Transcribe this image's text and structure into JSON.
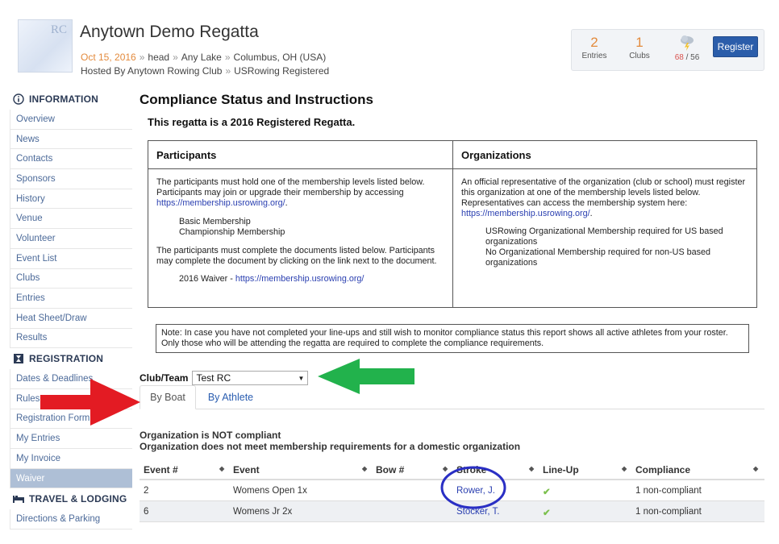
{
  "header": {
    "title": "Anytown Demo Regatta",
    "logo_text": "RC",
    "date": "Oct 15, 2016",
    "breadcrumb": [
      "head",
      "Any Lake",
      "Columbus, OH (USA)"
    ],
    "hosted_by": "Hosted By Anytown Rowing Club",
    "registered": "USRowing Registered",
    "stats": {
      "entries_count": "2",
      "entries_label": "Entries",
      "clubs_count": "1",
      "clubs_label": "Clubs",
      "weather_hi": "68",
      "weather_sep": "/",
      "weather_lo": "56"
    },
    "register_label": "Register"
  },
  "sidebar": {
    "info_heading": "INFORMATION",
    "info_items": [
      "Overview",
      "News",
      "Contacts",
      "Sponsors",
      "History",
      "Venue",
      "Volunteer",
      "Event List",
      "Clubs",
      "Entries",
      "Heat Sheet/Draw",
      "Results"
    ],
    "registration_heading": "REGISTRATION",
    "registration_items": [
      "Dates & Deadlines",
      "Rules",
      "Registration Form",
      "My Entries",
      "My Invoice",
      "Waiver"
    ],
    "travel_heading": "TRAVEL & LODGING",
    "travel_items": [
      "Directions & Parking"
    ]
  },
  "main": {
    "title": "Compliance Status and Instructions",
    "subtitle": "This regatta is a 2016 Registered Regatta.",
    "participants": {
      "heading": "Participants",
      "p1": "The participants must hold one of the membership levels listed below. Participants may join or upgrade their membership by accessing ",
      "link": "https://membership.usrowing.org/",
      "p1_end": ".",
      "levels": [
        "Basic Membership",
        "Championship Membership"
      ],
      "p2": "The participants must complete the documents listed below. Participants may complete the document by clicking on the link next to the document.",
      "doc": "2016 Waiver - ",
      "doc_link": "https://membership.usrowing.org/"
    },
    "organizations": {
      "heading": "Organizations",
      "p1": "An official representative of the organization (club or school) must register this organization at one of the membership levels listed below. Representatives can access the membership system here: ",
      "link": "https://membership.usrowing.org/",
      "p1_end": ".",
      "req1": "USRowing Organizational Membership required for US based organizations",
      "req2": "No Organizational Membership required for non-US based organizations"
    },
    "note": "Note: In case you have not completed your line-ups and still wish to monitor compliance status this report shows all active athletes from your roster. Only those who will be attending the regatta are required to complete the compliance requirements.",
    "club_label": "Club/Team",
    "club_value": "Test RC",
    "tabs": [
      "By Boat",
      "By Athlete"
    ],
    "status_line1": "Organization is NOT compliant",
    "status_line2": "Organization does not meet membership requirements for a domestic organization",
    "table": {
      "headers": [
        "Event #",
        "Event",
        "Bow #",
        "Stroke",
        "Line-Up",
        "Compliance"
      ],
      "rows": [
        {
          "event_num": "2",
          "event": "Womens Open 1x",
          "bow": "",
          "stroke": "Rower, J.",
          "lineup": "✔",
          "compliance": "1 non-compliant"
        },
        {
          "event_num": "6",
          "event": "Womens Jr 2x",
          "bow": "",
          "stroke": "Stocker, T.",
          "lineup": "✔",
          "compliance": "1 non-compliant"
        }
      ]
    }
  },
  "colors": {
    "accent": "#e38a3c",
    "link": "#2a3fb0",
    "primary": "#2b5daa",
    "arrow_red": "#e31b23",
    "arrow_green": "#22b24c",
    "circle_blue": "#2a2fc4"
  }
}
